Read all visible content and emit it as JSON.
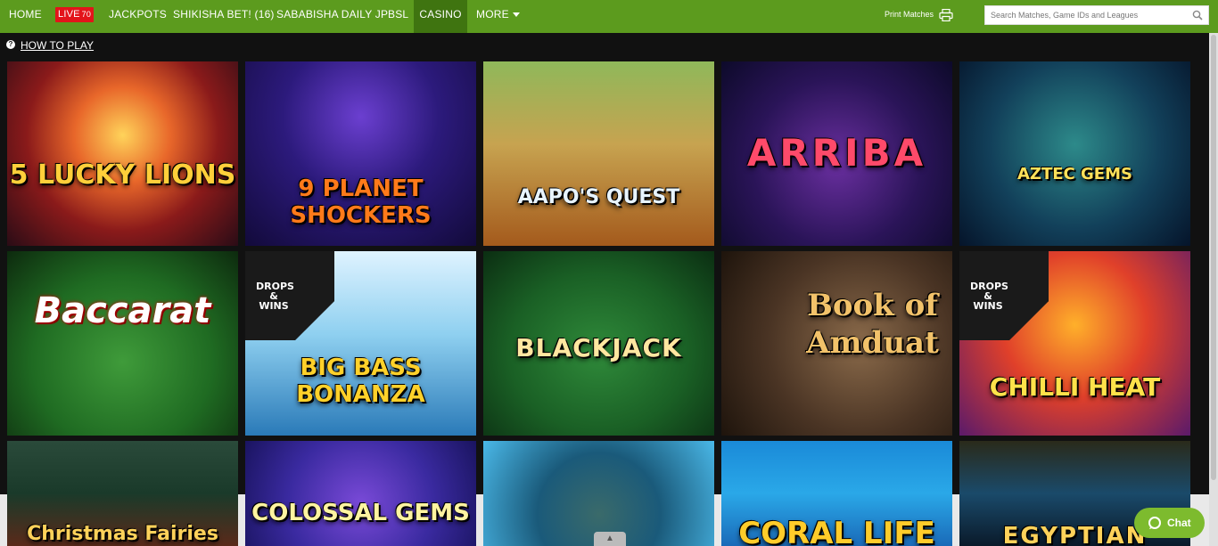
{
  "nav": {
    "home": "HOME",
    "live": "LIVE",
    "live_count": "70",
    "jackpots": "JACKPOTS",
    "shikisha": "SHIKISHA BET! (16)",
    "sababisha": "SABABISHA DAILY JP",
    "bsl": "BSL",
    "casino": "CASINO",
    "more": "MORE",
    "print": "Print Matches",
    "search_placeholder": "Search Matches, Game IDs and Leagues"
  },
  "howto": "HOW TO PLAY",
  "games": [
    {
      "title": "5 LUCKY LIONS"
    },
    {
      "title": "9 PLANET SHOCKERS"
    },
    {
      "title": "AAPO'S QUEST"
    },
    {
      "title": "ARRIBA"
    },
    {
      "title": "AZTEC GEMS"
    },
    {
      "title": "Baccarat"
    },
    {
      "title": "BIG BASS BONANZA"
    },
    {
      "title": "BLACKJACK"
    },
    {
      "title": "Book of Amduat"
    },
    {
      "title": "CHILLI HEAT"
    },
    {
      "title": "Christmas Fairies"
    },
    {
      "title": "COLOSSAL GEMS"
    },
    {
      "title": ""
    },
    {
      "title": "CORAL LIFE"
    },
    {
      "title": "EGYPTIAN"
    }
  ],
  "badges": {
    "drops_wins_1": "DROPS & WINS",
    "drops_wins_2": "DROPS & WINS"
  },
  "chat": "Chat",
  "colors": {
    "nav_green": "#5c9b1e",
    "active_green": "#3f7410",
    "live_red": "#e3141a",
    "chat_green": "#7dbb2e"
  }
}
